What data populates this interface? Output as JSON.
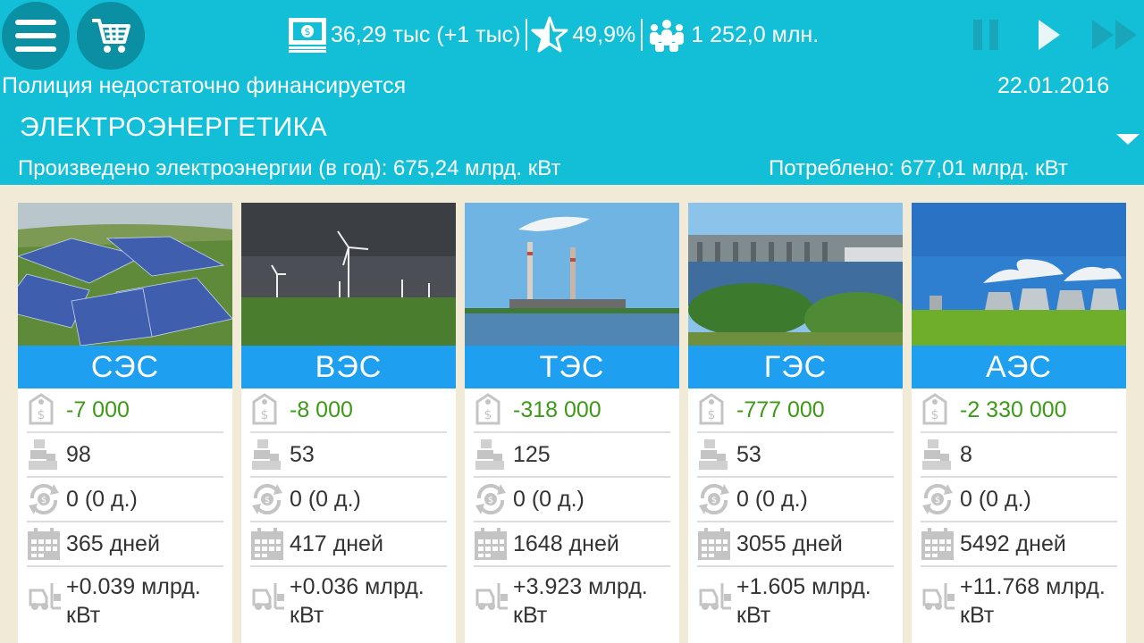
{
  "stats": {
    "money": "36,29 тыс (+1 тыс)",
    "rating": "49,9%",
    "population": "1 252,0 млн."
  },
  "status_message": "Полиция недостаточно финансируется",
  "date": "22.01.2016",
  "section_title": "ЭЛЕКТРОЭНЕРГЕТИКА",
  "produced": "Произведено электроэнергии (в год): 675,24 млрд. кВт",
  "consumed": "Потреблено: 677,01 млрд. кВт",
  "icons": {
    "menu": "menu-icon",
    "cart": "cart-icon",
    "money": "banknote-icon",
    "rating": "star-icon",
    "population": "people-icon",
    "pause": "pause-icon",
    "play": "play-icon",
    "fast_forward": "fast-forward-icon",
    "cost": "price-tag-icon",
    "count": "factory-stack-icon",
    "income": "cycle-coin-icon",
    "days": "calendar-icon",
    "power": "forklift-icon"
  },
  "colors": {
    "topbar": "#12bfd6",
    "card_title": "#1e9ff0",
    "negative_value": "#3c9a16",
    "background": "#f1ead6"
  },
  "plants": [
    {
      "name": "СЭС",
      "cost": "-7 000",
      "count": "98",
      "income": "0 (0 д.)",
      "days": "365 дней",
      "power": "+0.039 млрд. кВт"
    },
    {
      "name": "ВЭС",
      "cost": "-8 000",
      "count": "53",
      "income": "0 (0 д.)",
      "days": "417 дней",
      "power": "+0.036 млрд. кВт"
    },
    {
      "name": "ТЭС",
      "cost": "-318 000",
      "count": "125",
      "income": "0 (0 д.)",
      "days": "1648 дней",
      "power": "+3.923 млрд. кВт"
    },
    {
      "name": "ГЭС",
      "cost": "-777 000",
      "count": "53",
      "income": "0 (0 д.)",
      "days": "3055 дней",
      "power": "+1.605 млрд. кВт"
    },
    {
      "name": "АЭС",
      "cost": "-2 330 000",
      "count": "8",
      "income": "0 (0 д.)",
      "days": "5492 дней",
      "power": "+11.768 млрд. кВт"
    }
  ]
}
